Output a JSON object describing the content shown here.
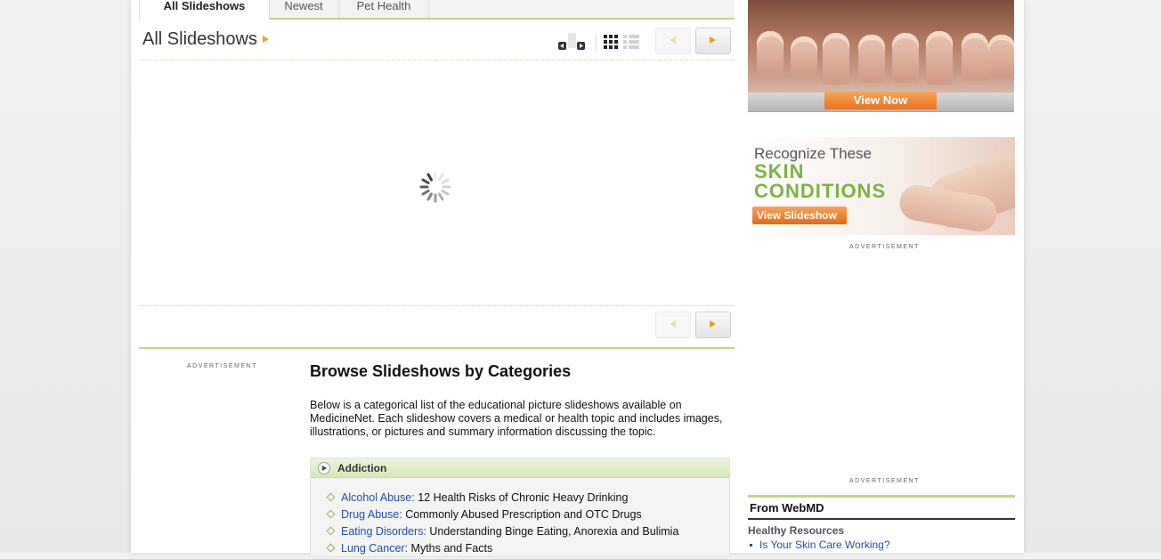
{
  "tabs": [
    {
      "label": "All Slideshows",
      "active": true
    },
    {
      "label": "Newest",
      "active": false
    },
    {
      "label": "Pet Health",
      "active": false
    }
  ],
  "main": {
    "title": "All Slideshows"
  },
  "ads": {
    "label": "ADVERTISEMENT"
  },
  "browse": {
    "heading": "Browse Slideshows by Categories",
    "description": "Below is a categorical list of the educational picture slideshows available on MedicineNet. Each slideshow covers a medical or health topic and includes images, illustrations, or pictures and summary information discussing the topic.",
    "category": "Addiction",
    "items": [
      {
        "link": "Alcohol Abuse:",
        "text": "12 Health Risks of Chronic Heavy Drinking"
      },
      {
        "link": "Drug Abuse:",
        "text": "Commonly Abused Prescription and OTC Drugs"
      },
      {
        "link": "Eating Disorders:",
        "text": "Understanding Binge Eating, Anorexia and Bulimia"
      },
      {
        "link": "Lung Cancer:",
        "text": "Myths and Facts"
      }
    ]
  },
  "promo1": {
    "button": "View Now"
  },
  "promo2": {
    "line1": "Recognize These",
    "line2a": "SKIN",
    "line2b": "CONDITIONS",
    "button": "View Slideshow"
  },
  "webmd": {
    "heading": "From WebMD",
    "subheading": "Healthy Resources",
    "link": "Is Your Skin Care Working?"
  },
  "colors": {
    "accent_green": "#b9d988",
    "link_blue": "#2151a4",
    "arrow_orange": "#f29b16"
  }
}
